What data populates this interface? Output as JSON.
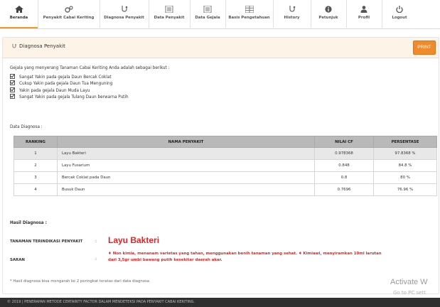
{
  "nav": {
    "items": [
      {
        "label": "Beranda",
        "icon": "home-icon"
      },
      {
        "label": "Penyakit Cabai Keriting",
        "icon": "gears-icon"
      },
      {
        "label": "Diagnosa Penyakit",
        "icon": "stethoscope-icon"
      },
      {
        "label": "Data Penyakit",
        "icon": "list-icon"
      },
      {
        "label": "Data Gejala",
        "icon": "list-icon"
      },
      {
        "label": "Basis Pengetahuan",
        "icon": "table-icon"
      },
      {
        "label": "History",
        "icon": "stethoscope-icon"
      },
      {
        "label": "Petunjuk",
        "icon": "info-icon"
      },
      {
        "label": "Profil",
        "icon": "user-icon"
      },
      {
        "label": "Logout",
        "icon": "power-icon"
      }
    ],
    "active_index": 0,
    "accent_color": "#f39a2a"
  },
  "panel": {
    "title": "Diagnosa Penyakit",
    "print_label": "PRINT"
  },
  "intro_text": "Gejala yang menyerang Tanaman Cabai Keriting Anda adalah sebagai berikut :",
  "symptoms": [
    "Sangat Yakin pada gejala Daun Bercak Coklat",
    "Cukup Yakin pada gejala Daun Tua Menguning",
    "Yakin pada gejala Daun Muda Layu",
    "Sangat Yakin pada gejala Tulang Daun berwarna Putih"
  ],
  "data_label": "Data Diagnosa :",
  "table": {
    "headers": [
      "RANKING",
      "NAMA PENYAKIT",
      "NILAI CF",
      "PERSENTASE"
    ],
    "rows": [
      [
        "1",
        "Layu Bakteri",
        "0.978368",
        "97.8368 %"
      ],
      [
        "2",
        "Layu Fusarium",
        "0.848",
        "84.8 %"
      ],
      [
        "3",
        "Bercak Coklat pada Daun",
        "0.8",
        "80 %"
      ],
      [
        "4",
        "Busuk Daun",
        "0.7696",
        "76.96 %"
      ]
    ]
  },
  "result": {
    "section_label": "Hasil Diagnosa :",
    "disease_label": "TANAMAN TERINDIKASI PENYAKIT",
    "disease_name": "Layu Bakteri",
    "advice_label": "SARAN",
    "colon": ":",
    "advice_line1": "♦ Non kimia, menanam varietas yang tahan, menggunakan benih tanaman yang sehat. ♦ Kimiawi, menyiramkan 10ml larutan",
    "advice_line2": "dari 3,5gr umbi bawang putih kesekitar daerah akar.",
    "note": "* Hasil diagnosa bisa mengarah ke 2 peringkat teratas dari data diagnosa",
    "accent_color": "#e02424"
  },
  "footer": {
    "text": "© 2019 | PENERAPAN METODE CERTAINTY FACTOR DALAM MENDETEKSI PADA PENYAKIT CABAI KERITING."
  },
  "watermark": {
    "line1": "Activate W",
    "line2": "Go to PC sett"
  }
}
